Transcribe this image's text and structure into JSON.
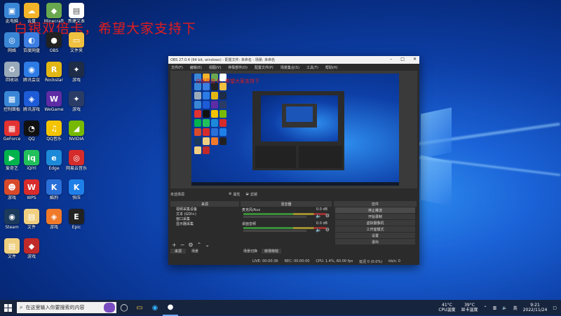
{
  "desktop": {
    "overlay_text": "白银双倍卡，希望大家支持下",
    "icons": [
      {
        "label": "此电脑",
        "color": "#3a86d6",
        "glyph": "▣"
      },
      {
        "label": "云盘",
        "color": "#f3b42a",
        "glyph": "☁"
      },
      {
        "label": "Minecraft",
        "color": "#6aa84f",
        "glyph": "◆"
      },
      {
        "label": "新建文本",
        "color": "#ffffff",
        "glyph": "▤"
      },
      {
        "label": "网络",
        "color": "#3a86d6",
        "glyph": "◎"
      },
      {
        "label": "百度网盘",
        "color": "#3b7de0",
        "glyph": "◐"
      },
      {
        "label": "OBS",
        "color": "#222",
        "glyph": "●"
      },
      {
        "label": "文件夹",
        "color": "#f0c040",
        "glyph": "▭"
      },
      {
        "label": "回收站",
        "color": "#9ab",
        "glyph": "♻"
      },
      {
        "label": "腾讯会议",
        "color": "#2d7be5",
        "glyph": "◉"
      },
      {
        "label": "Rockstar",
        "color": "#e2b714",
        "glyph": "R"
      },
      {
        "label": "游戏",
        "color": "#1e2c48",
        "glyph": "✦"
      },
      {
        "label": "控制面板",
        "color": "#3a86d6",
        "glyph": "▦"
      },
      {
        "label": "腾讯游戏",
        "color": "#1e5bd6",
        "glyph": "◈"
      },
      {
        "label": "WeGame",
        "color": "#5e2ca5",
        "glyph": "W"
      },
      {
        "label": "游戏",
        "color": "#2a3c66",
        "glyph": "✦"
      },
      {
        "label": "GeForce",
        "color": "#e23232",
        "glyph": "▦"
      },
      {
        "label": "QQ",
        "color": "#111",
        "glyph": "◔"
      },
      {
        "label": "QQ音乐",
        "color": "#f5c400",
        "glyph": "♫"
      },
      {
        "label": "NVIDIA",
        "color": "#76b900",
        "glyph": "◢"
      },
      {
        "label": "爱奇艺",
        "color": "#00b34d",
        "glyph": "▶"
      },
      {
        "label": "iQIYI",
        "color": "#22c05b",
        "glyph": "iq"
      },
      {
        "label": "Edge",
        "color": "#1c8ad8",
        "glyph": "e"
      },
      {
        "label": "网易云音乐",
        "color": "#d52b2b",
        "glyph": "◎"
      },
      {
        "label": "游戏",
        "color": "#d84a2a",
        "glyph": "☻"
      },
      {
        "label": "WPS",
        "color": "#d82b2b",
        "glyph": "W"
      },
      {
        "label": "酷狗",
        "color": "#2a6fd8",
        "glyph": "K"
      },
      {
        "label": "快压",
        "color": "#1f7fe8",
        "glyph": "K"
      },
      {
        "label": "Steam",
        "color": "#1b3a5c",
        "glyph": "◉"
      },
      {
        "label": "文件",
        "color": "#f0d080",
        "glyph": "▤"
      },
      {
        "label": "游戏",
        "color": "#f07a2a",
        "glyph": "◈"
      },
      {
        "label": "Epic",
        "color": "#222",
        "glyph": "E"
      },
      {
        "label": "文件",
        "color": "#f0d080",
        "glyph": "▤"
      },
      {
        "label": "游戏",
        "color": "#c02a2a",
        "glyph": "◆"
      }
    ]
  },
  "obs": {
    "title": "OBS 27.0.4 (64 bit, windows) - 配置文件: 未命名 - 场景: 未命名",
    "menu": [
      "文件(F)",
      "编辑(E)",
      "视图(V)",
      "停靠部件(D)",
      "配置文件(P)",
      "场景集合(S)",
      "工具(T)",
      "帮助(H)"
    ],
    "preview_overlay_text": "白银双倍卡，希望大家支持下",
    "controls_row": [
      "属性",
      "滤镜"
    ],
    "scene_label": "未选择源",
    "sources_header": "来源",
    "sources": [
      "视频采集设备",
      "文本 (GDI+)",
      "窗口采集",
      "显示器采集"
    ],
    "mixer_header": "混音器",
    "mixer_channels": [
      {
        "name": "麦克风/Aux",
        "db": "0.0 dB"
      },
      {
        "name": "桌面音频",
        "db": "0.0 dB"
      }
    ],
    "transition_tabs": [
      "场景切换",
      "转场特效"
    ],
    "scene_tabs": [
      "来源",
      "场景"
    ],
    "controls_header": "控件",
    "controls": [
      "停止推流",
      "开始录制",
      "虚拟摄像机",
      "工作室模式",
      "设置",
      "退出"
    ],
    "status": {
      "live": "LIVE: 00:00:36",
      "rec": "REC: 00:00:00",
      "cpu": "CPU: 1.4%, 60.00 fps",
      "dropped": "延迟 0 (0.0%)",
      "kbs": "kb/s: 0"
    }
  },
  "taskbar": {
    "search_placeholder": "在这里输入你要搜索的内容",
    "weather1": "41°C",
    "weather1_sub": "CPU温度",
    "weather2": "39°C",
    "weather2_sub": "显卡温度",
    "lang": "英",
    "time": "9:21",
    "date": "2022/11/24"
  }
}
